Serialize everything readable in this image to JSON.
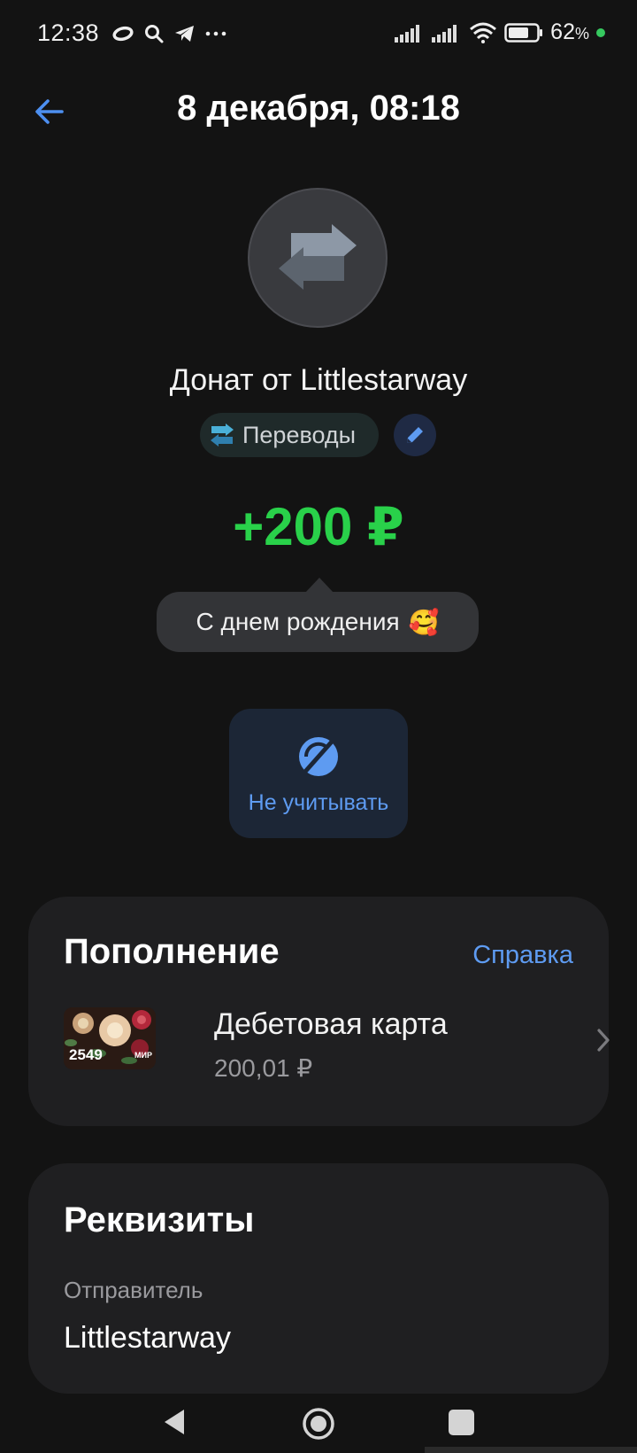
{
  "status_bar": {
    "time": "12:38",
    "battery_percent": "62",
    "battery_unit": "%"
  },
  "header": {
    "title": "8 декабря, 08:18"
  },
  "transaction": {
    "title": "Донат от Littlestarway",
    "category": "Переводы",
    "amount": "+200 ₽",
    "message": "С днем рождения",
    "message_emoji": "🥰",
    "amount_color": "#29d14a"
  },
  "ignore_button": {
    "label": "Не учитывать"
  },
  "topup_section": {
    "title": "Пополнение",
    "help_link": "Справка",
    "card": {
      "name": "Дебетовая карта",
      "balance": "200,01 ₽",
      "last_digits": "2549",
      "payment_system": "МИР"
    }
  },
  "details_section": {
    "title": "Реквизиты",
    "sender_label": "Отправитель",
    "sender_value": "Littlestarway"
  },
  "colors": {
    "background": "#131313",
    "card": "#1f1f21",
    "accent_blue": "#5e9bf1",
    "positive_green": "#29d14a"
  }
}
